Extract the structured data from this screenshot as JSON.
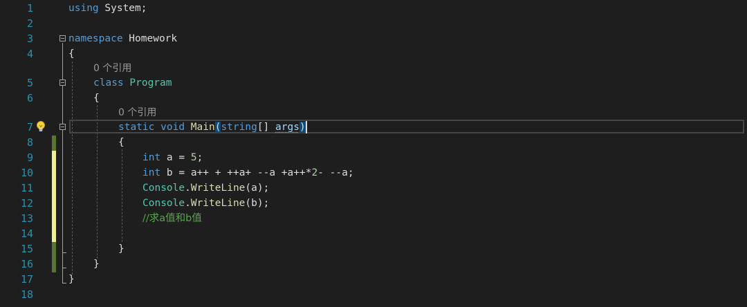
{
  "editor": {
    "lines": [
      {
        "n": "1",
        "tokens": [
          {
            "t": "using",
            "c": "kw"
          },
          {
            "t": " System;",
            "c": "id"
          }
        ]
      },
      {
        "n": "2",
        "tokens": []
      },
      {
        "n": "3",
        "tokens": [
          {
            "t": "namespace",
            "c": "kw"
          },
          {
            "t": " Homework",
            "c": "id"
          }
        ]
      },
      {
        "n": "4",
        "tokens": [
          {
            "t": "{",
            "c": "id"
          }
        ]
      },
      {
        "n": "5",
        "tokens": [
          {
            "t": "class",
            "c": "kw"
          },
          {
            "t": " ",
            "c": "id"
          },
          {
            "t": "Program",
            "c": "ty"
          }
        ]
      },
      {
        "n": "6",
        "tokens": [
          {
            "t": "{",
            "c": "id"
          }
        ]
      },
      {
        "n": "7",
        "tokens": [
          {
            "t": "static",
            "c": "kw"
          },
          {
            "t": " ",
            "c": "id"
          },
          {
            "t": "void",
            "c": "kw"
          },
          {
            "t": " ",
            "c": "id"
          },
          {
            "t": "Main",
            "c": "fn"
          },
          {
            "t": "(",
            "c": "id paren-hl"
          },
          {
            "t": "string",
            "c": "kw"
          },
          {
            "t": "[] ",
            "c": "id"
          },
          {
            "t": "args",
            "c": "pa squig"
          },
          {
            "t": ")",
            "c": "id paren-hl"
          }
        ]
      },
      {
        "n": "8",
        "tokens": [
          {
            "t": "{",
            "c": "id"
          }
        ]
      },
      {
        "n": "9",
        "tokens": [
          {
            "t": "int",
            "c": "kw"
          },
          {
            "t": " a = ",
            "c": "id"
          },
          {
            "t": "5",
            "c": "num"
          },
          {
            "t": ";",
            "c": "id"
          }
        ]
      },
      {
        "n": "10",
        "tokens": [
          {
            "t": "int",
            "c": "kw"
          },
          {
            "t": " b = a++ + ++a+ --a +a++*",
            "c": "id"
          },
          {
            "t": "2",
            "c": "num"
          },
          {
            "t": "- --a;",
            "c": "id"
          }
        ]
      },
      {
        "n": "11",
        "tokens": [
          {
            "t": "Console",
            "c": "ty"
          },
          {
            "t": ".",
            "c": "id"
          },
          {
            "t": "WriteLine",
            "c": "fn"
          },
          {
            "t": "(a);",
            "c": "id"
          }
        ]
      },
      {
        "n": "12",
        "tokens": [
          {
            "t": "Console",
            "c": "ty"
          },
          {
            "t": ".",
            "c": "id"
          },
          {
            "t": "WriteLine",
            "c": "fn"
          },
          {
            "t": "(b);",
            "c": "id"
          }
        ]
      },
      {
        "n": "13",
        "tokens": [
          {
            "t": "//求a值和b值",
            "c": "cm"
          }
        ]
      },
      {
        "n": "14",
        "tokens": []
      },
      {
        "n": "15",
        "tokens": [
          {
            "t": "}",
            "c": "id"
          }
        ]
      },
      {
        "n": "16",
        "tokens": [
          {
            "t": "}",
            "c": "id"
          }
        ]
      },
      {
        "n": "17",
        "tokens": [
          {
            "t": "}",
            "c": "id"
          }
        ]
      },
      {
        "n": "18",
        "tokens": []
      }
    ],
    "codelens": [
      {
        "text": "0 个引用"
      },
      {
        "text": "0 个引用"
      }
    ],
    "colors": {
      "background": "#1e1e1e",
      "line_number": "#2b91af",
      "keyword": "#569cd6",
      "type": "#4ec9b0",
      "method": "#dcdcaa",
      "comment": "#57a64a",
      "saved_change": "#577430",
      "unsaved_change": "#efef91"
    },
    "icons": {
      "quick_actions": "lightbulb-icon",
      "collapse": "collapse-minus-icon"
    }
  }
}
